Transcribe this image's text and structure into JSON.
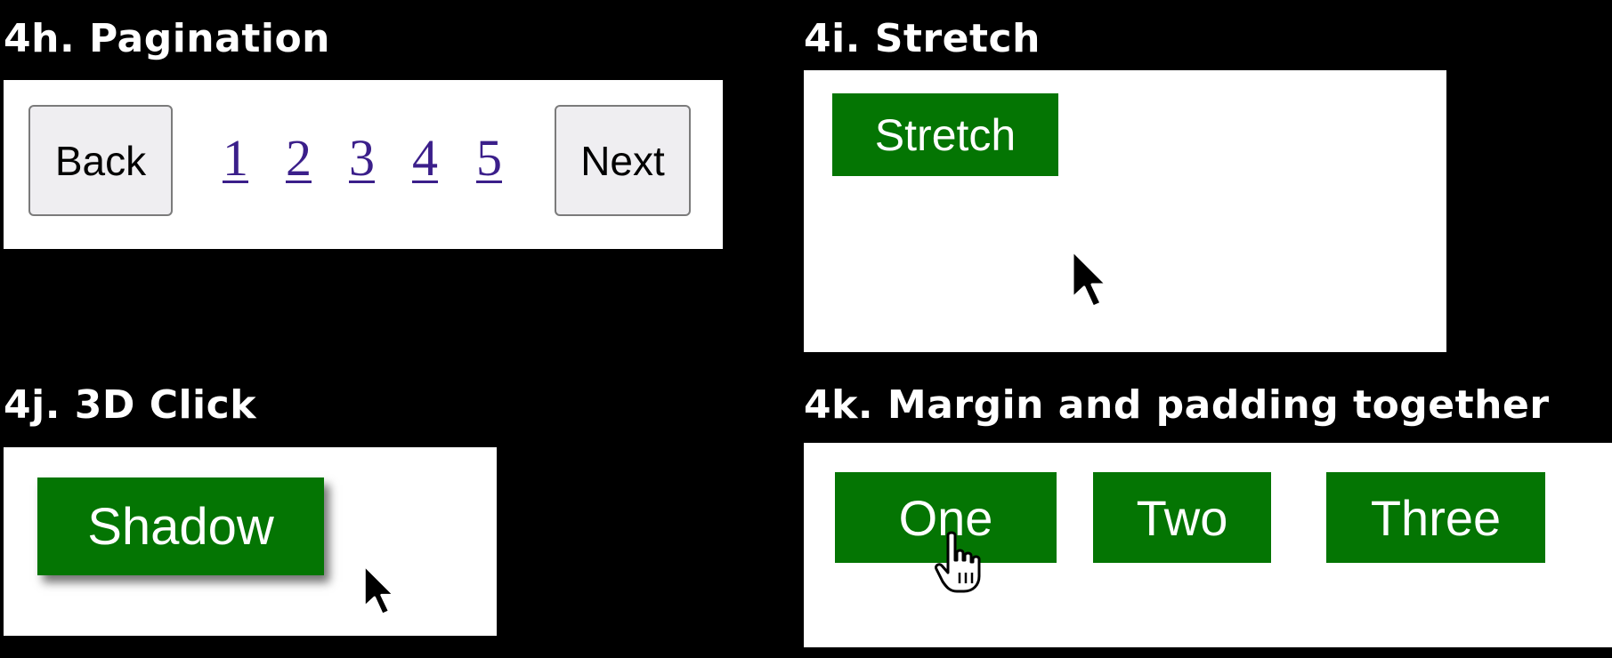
{
  "sections": {
    "pagination": {
      "title": "4h. Pagination",
      "back_label": "Back",
      "next_label": "Next",
      "pages": [
        "1",
        "2",
        "3",
        "4",
        "5"
      ]
    },
    "stretch": {
      "title": "4i. Stretch",
      "button_label": "Stretch"
    },
    "click3d": {
      "title": "4j. 3D Click",
      "button_label": "Shadow"
    },
    "margin_padding": {
      "title": "4k. Margin and padding together",
      "buttons": [
        "One",
        "Two",
        "Three"
      ]
    }
  },
  "colors": {
    "button_green": "#047503",
    "link_purple": "#3b1f8a",
    "background": "#000000",
    "panel": "#ffffff"
  },
  "icons": [
    "arrow-cursor-icon",
    "hand-pointer-icon"
  ]
}
